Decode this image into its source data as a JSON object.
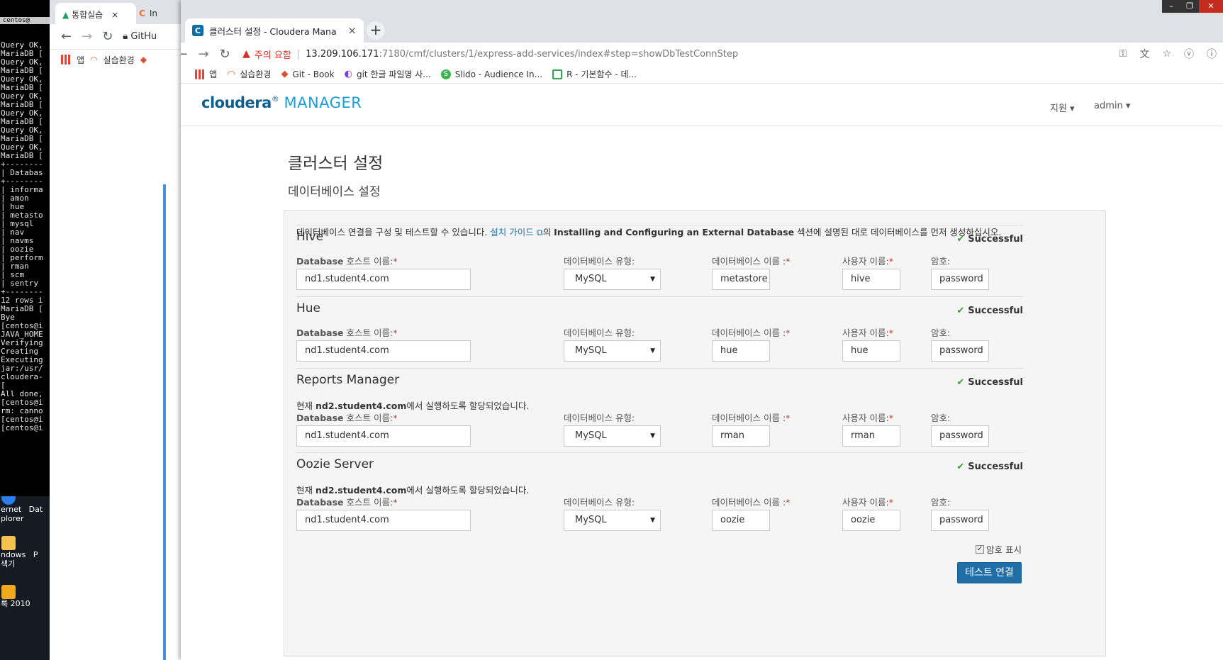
{
  "terminal": {
    "title": "centos@",
    "lines": [
      "Query OK,",
      "",
      "MariaDB [",
      "Query OK,",
      "",
      "MariaDB [",
      "Query OK,",
      "",
      "MariaDB [",
      "Query OK,",
      "",
      "MariaDB [",
      "Query OK,",
      "",
      "MariaDB [",
      "Query OK,",
      "",
      "MariaDB [",
      "Query OK,",
      "",
      "MariaDB [",
      "+--------",
      "| Databas",
      "+--------",
      "| informa",
      "| amon",
      "| hue",
      "| metasto",
      "| mysql",
      "| nav",
      "| navms",
      "| oozie",
      "| perform",
      "| rman",
      "| scm",
      "| sentry",
      "+--------",
      "12 rows i",
      "",
      "MariaDB [",
      "Bye",
      "[centos@i",
      "JAVA_HOME",
      "Verifying",
      "Creating ",
      "Executing",
      "jar:/usr/",
      "cloudera-",
      "[",
      "All done,",
      "[centos@i",
      "rm: canno",
      "[centos@i",
      "[centos@i"
    ]
  },
  "desktop": {
    "icons": [
      {
        "label": "ernet",
        "label2": "plorer",
        "side": "Dat"
      },
      {
        "label": "ndows",
        "label2": "색기",
        "side": "P"
      },
      {
        "label": "룩 2010",
        "label2": "",
        "side": ""
      }
    ]
  },
  "bg_browser": {
    "tab_label": "통합실습",
    "tab2_label": "In",
    "omnibox": "GitHu",
    "bookmark_apps": "앱",
    "bookmark_env": "실습환경"
  },
  "browser": {
    "tab_title": "클러스터 설정 - Cloudera Mana",
    "tab_close": "×",
    "new_tab": "+",
    "warning_label": "주의 요함",
    "url_host": "13.209.106.171",
    "url_path": ":7180/cmf/clusters/1/express-add-services/index#step=showDbTestConnStep",
    "bookmarks": [
      {
        "label": "앱",
        "color": "#e94235"
      },
      {
        "label": "실습환경",
        "color": "#f06a2a"
      },
      {
        "label": "Git - Book",
        "color": "#e14f2b"
      },
      {
        "label": "git 한글 파일명 사...",
        "color": "#7b3fe4"
      },
      {
        "label": "Slido - Audience In...",
        "color": "#3fb34f"
      },
      {
        "label": "R - 기본함수 - 데...",
        "color": "#2ba84a"
      }
    ]
  },
  "header": {
    "logo_part1": "cloudera",
    "logo_part2": "MANAGER",
    "support": "지원 ▾",
    "admin": "admin ▾"
  },
  "page": {
    "title": "클러스터 설정",
    "subtitle": "데이터베이스 설정",
    "intro_before": "데이터베이스 연결을 구성 및 테스트할 수 있습니다. ",
    "intro_link": "설치 가이드 ",
    "intro_mid": "의 ",
    "intro_bold": "Installing and Configuring an External Database",
    "intro_after": " 섹션에 설명된 대로 데이터베이스를 먼저 생성하십시오."
  },
  "labels": {
    "host_prefix": "Database",
    "host_suffix": " 호스트 이름:",
    "db_type": "데이터베이스 유형:",
    "db_name": "데이터베이스 이름 :",
    "user": "사용자 이름:",
    "password": "암호:",
    "required": "*",
    "note_prefix": "현재 ",
    "note_suffix": "에서 실행하도록 할당되었습니다."
  },
  "sections": [
    {
      "title": "Hive",
      "status": "Successful",
      "note_host": "",
      "host": "nd1.student4.com",
      "db_type": "MySQL",
      "db_name": "metastore",
      "user": "hive",
      "password": "password"
    },
    {
      "title": "Hue",
      "status": "Successful",
      "note_host": "",
      "host": "nd1.student4.com",
      "db_type": "MySQL",
      "db_name": "hue",
      "user": "hue",
      "password": "password"
    },
    {
      "title": "Reports Manager",
      "status": "Successful",
      "note_host": "nd2.student4.com",
      "host": "nd1.student4.com",
      "db_type": "MySQL",
      "db_name": "rman",
      "user": "rman",
      "password": "password"
    },
    {
      "title": "Oozie Server",
      "status": "Successful",
      "note_host": "nd2.student4.com",
      "host": "nd1.student4.com",
      "db_type": "MySQL",
      "db_name": "oozie",
      "user": "oozie",
      "password": "password"
    }
  ],
  "footer": {
    "show_password": "암호 표시",
    "show_password_checked": true,
    "test_button": "테스트 연결"
  }
}
